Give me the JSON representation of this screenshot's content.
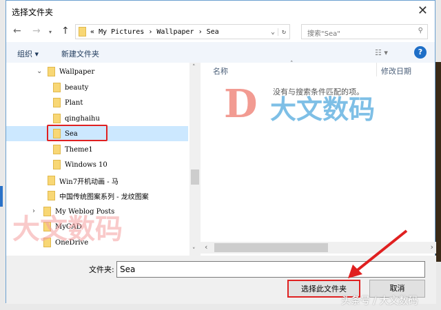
{
  "title": "选择文件夹",
  "nav": {
    "path": [
      "My Pictures",
      "Wallpaper",
      "Sea"
    ],
    "path_prefix": "«",
    "search_placeholder": "搜索\"Sea\""
  },
  "toolbar": {
    "organize": "组织 ▾",
    "new_folder": "新建文件夹",
    "help": "?"
  },
  "tree": [
    {
      "label": "Wallpaper"
    },
    {
      "label": "beauty"
    },
    {
      "label": "Plant"
    },
    {
      "label": "qinghaihu"
    },
    {
      "label": "Sea"
    },
    {
      "label": "Theme1"
    },
    {
      "label": "Windows 10"
    },
    {
      "label": "Win7开机动画 - 马"
    },
    {
      "label": "中国传统图案系列 - 龙纹图案"
    },
    {
      "label": "My Weblog Posts"
    },
    {
      "label": "MyCAD"
    },
    {
      "label": "OneDrive"
    }
  ],
  "columns": {
    "name": "名称",
    "modified": "修改日期"
  },
  "empty_message": "没有与搜索条件匹配的项。",
  "folder_label": "文件夹:",
  "folder_value": "Sea",
  "buttons": {
    "select": "选择此文件夹",
    "cancel": "取消"
  },
  "watermarks": {
    "main": "大文数码",
    "toutiao": "头条号 / 大文数码",
    "logo_letter": "D"
  }
}
